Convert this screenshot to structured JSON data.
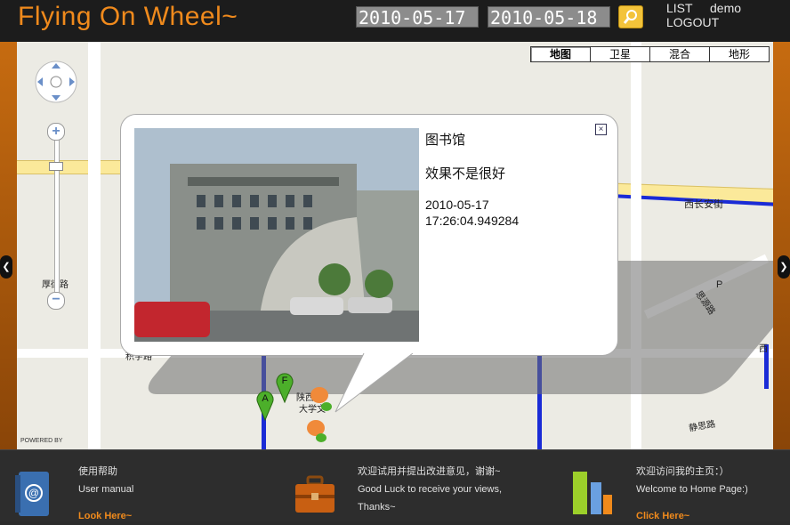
{
  "header": {
    "logo": "Flying On Wheel~",
    "start_date": "2010-05-17",
    "end_date": "2010-05-18",
    "search_icon": "magnifier-icon",
    "list_link": "LIST",
    "user": "demo",
    "logout_link": "LOGOUT"
  },
  "map": {
    "types": [
      "地图",
      "卫星",
      "混合",
      "地形"
    ],
    "active_type": "地图",
    "labels": {
      "road1": "西长安街",
      "road2": "厚街路",
      "road3": "积字路",
      "road4": "静思路",
      "road5": "思源路",
      "poi_p": "P",
      "west": "西",
      "poi_cluster1": "陕西",
      "poi_cluster2": "大学文",
      "powered_by": "POWERED BY"
    },
    "markers": [
      {
        "label": "A",
        "color": "#4caf2a"
      },
      {
        "label": "F",
        "color": "#4caf2a"
      }
    ],
    "infowindow": {
      "title": "图书馆",
      "comment": "效果不是很好",
      "date": "2010-05-17",
      "time": "17:26:04.949284",
      "close_icon": "close-icon"
    }
  },
  "footer": {
    "help": {
      "cn": "使用帮助",
      "en": "User manual",
      "link": "Look Here~"
    },
    "feedback": {
      "cn": "欢迎试用并提出改进意见，谢谢~",
      "en": "Good Luck to receive your views,",
      "en2": "Thanks~"
    },
    "home": {
      "cn": "欢迎访问我的主页：）",
      "en": "Welcome to Home Page:)",
      "link": "Click Here~"
    }
  },
  "colors": {
    "brand": "#f08a1c",
    "header_bg": "#1c1c1c",
    "route": "#1a2bd6"
  }
}
